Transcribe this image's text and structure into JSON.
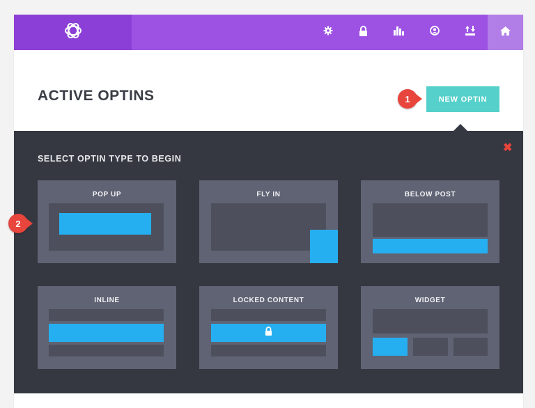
{
  "header": {
    "logo_icon": "divi-bloom-logo-icon",
    "nav_icons": [
      "gear-icon",
      "lock-icon",
      "bar-chart-icon",
      "user-circle-icon",
      "import-export-icon",
      "home-icon"
    ],
    "active_nav": "home-icon"
  },
  "page": {
    "title": "ACTIVE OPTINS",
    "new_optin_label": "NEW OPTIN"
  },
  "callouts": {
    "first": "1",
    "second": "2"
  },
  "selector": {
    "title": "SELECT OPTIN TYPE TO BEGIN",
    "close_icon": "close-x-icon",
    "types": [
      {
        "label": "POP UP"
      },
      {
        "label": "FLY IN"
      },
      {
        "label": "BELOW POST"
      },
      {
        "label": "INLINE"
      },
      {
        "label": "LOCKED CONTENT"
      },
      {
        "label": "WIDGET"
      }
    ]
  },
  "colors": {
    "brand_purple": "#9d52e3",
    "accent_teal": "#55d0cb",
    "highlight_blue": "#26aff0",
    "callout_red": "#e8453c",
    "dark_bg": "#363841"
  }
}
